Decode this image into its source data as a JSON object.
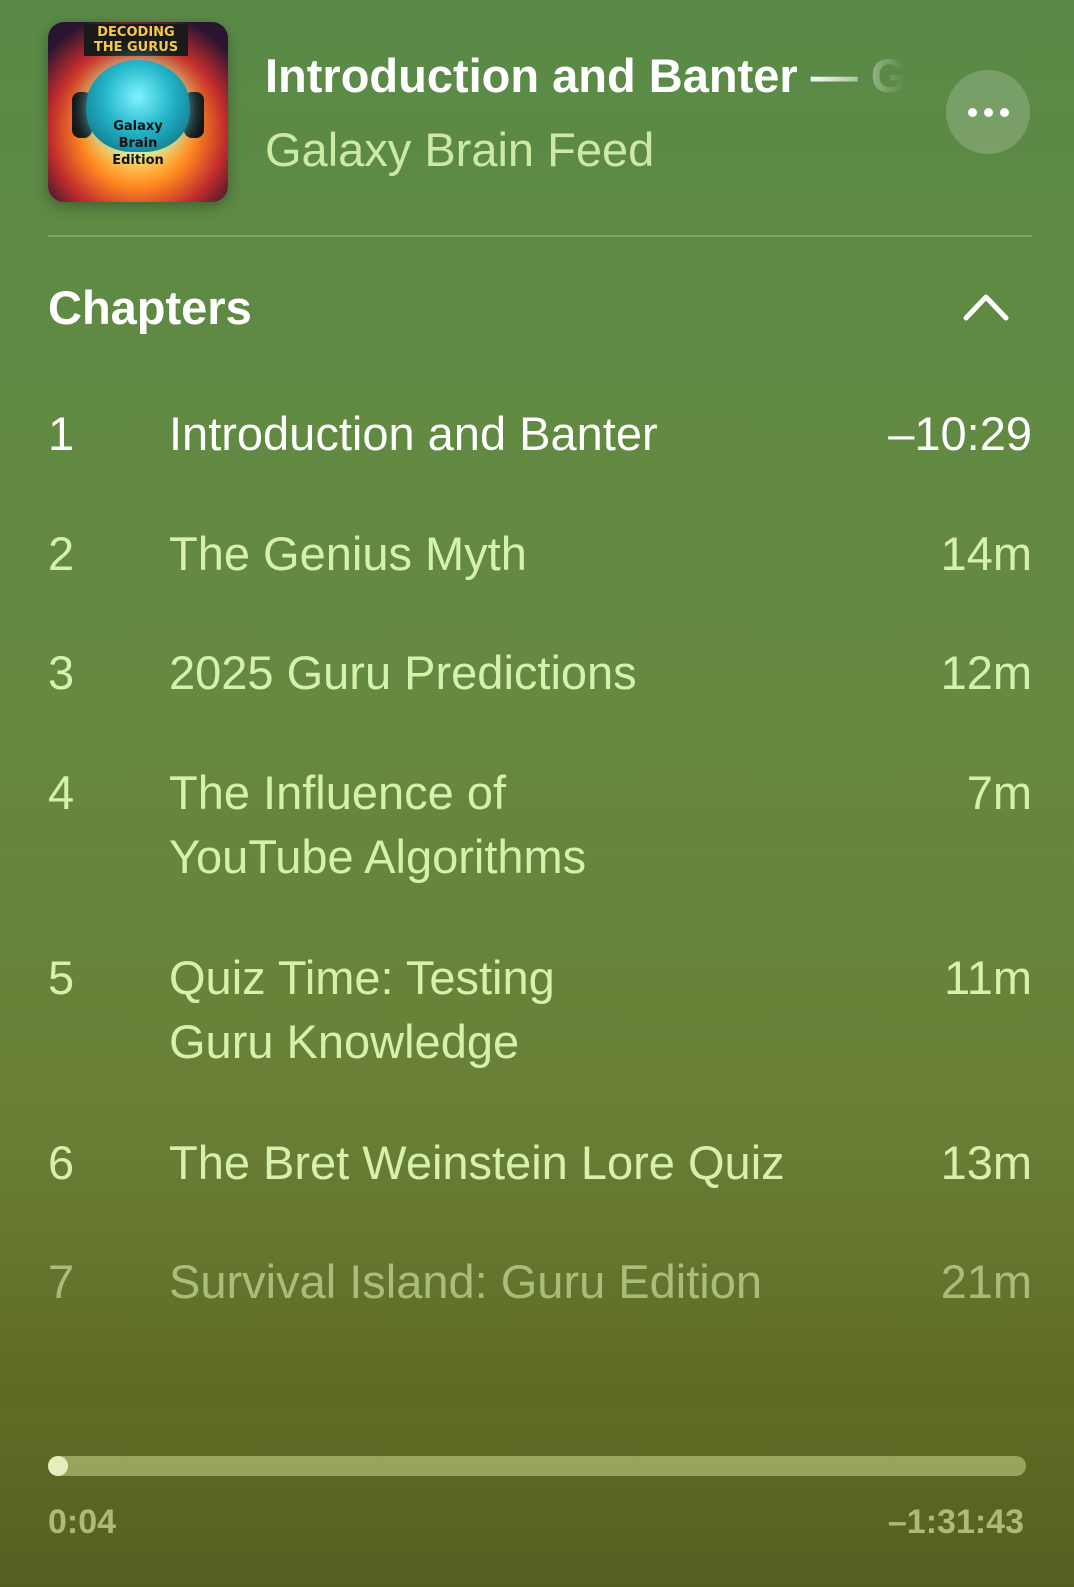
{
  "header": {
    "artwork": {
      "title_text": "DECODING THE GURUS",
      "subtitle_text": "Galaxy\nBrain\nEdition"
    },
    "episode_title": "Introduction and Banter — Galaxy Brain Edition",
    "show_name": "Galaxy Brain Feed",
    "more_icon": "ellipsis-icon"
  },
  "chapters": {
    "heading": "Chapters",
    "collapse_icon": "chevron-up-icon",
    "items": [
      {
        "number": "1",
        "title": "Introduction and Banter",
        "duration": "–10:29",
        "state": "current"
      },
      {
        "number": "2",
        "title": "The Genius Myth",
        "duration": "14m",
        "state": "upcoming"
      },
      {
        "number": "3",
        "title": "2025 Guru Predictions",
        "duration": "12m",
        "state": "upcoming"
      },
      {
        "number": "4",
        "title": "The Influence of\nYouTube Algorithms",
        "duration": "7m",
        "state": "upcoming"
      },
      {
        "number": "5",
        "title": "Quiz Time: Testing\nGuru Knowledge",
        "duration": "11m",
        "state": "upcoming"
      },
      {
        "number": "6",
        "title": "The Bret Weinstein Lore Quiz",
        "duration": "13m",
        "state": "upcoming"
      },
      {
        "number": "7",
        "title": "Survival Island: Guru Edition",
        "duration": "21m",
        "state": "faded"
      }
    ]
  },
  "playback": {
    "elapsed": "0:04",
    "remaining": "–1:31:43",
    "progress_fraction": 0.001
  },
  "colors": {
    "background_top": "#5a8a48",
    "background_bottom": "#555e20",
    "accent_text": "#d6f0ad"
  }
}
